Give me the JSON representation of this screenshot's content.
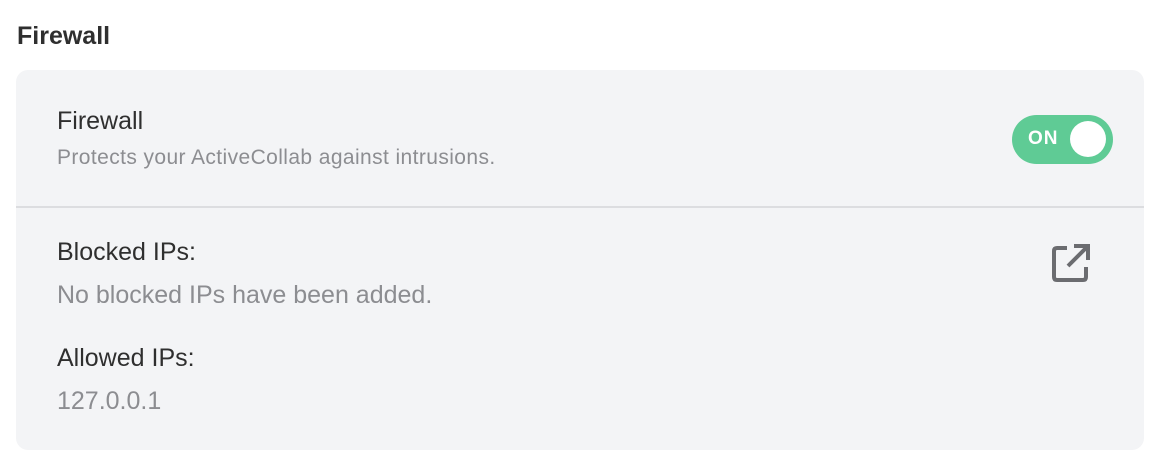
{
  "section": {
    "title": "Firewall"
  },
  "firewall": {
    "title": "Firewall",
    "description": "Protects your ActiveCollab against intrusions.",
    "toggle": {
      "label": "ON",
      "state": true,
      "color": "#5fcb95"
    }
  },
  "blocked_ips": {
    "label": "Blocked IPs:",
    "value": "No blocked IPs have been added.",
    "action_icon": "external-link-icon"
  },
  "allowed_ips": {
    "label": "Allowed IPs:",
    "value": "127.0.0.1"
  }
}
